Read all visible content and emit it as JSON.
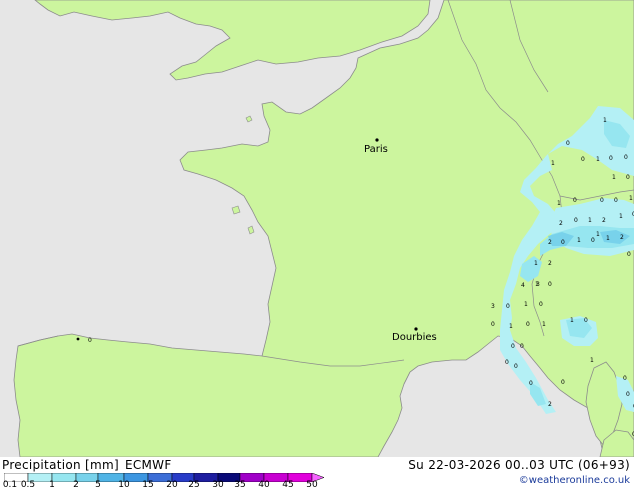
{
  "map": {
    "cities": [
      {
        "name": "Paris"
      },
      {
        "name": "Dourbies"
      }
    ],
    "precip_labels": [
      "1",
      "0",
      "1",
      "0",
      "1",
      "0",
      "0",
      "1",
      "0",
      "1",
      "0",
      "0",
      "0",
      "1",
      "2",
      "0",
      "1",
      "2",
      "1",
      "0",
      "2",
      "0",
      "1",
      "0",
      "1",
      "2",
      "1",
      "2",
      "4",
      "3",
      "3",
      "0",
      "1",
      "0",
      "1",
      "0",
      "1",
      "1",
      "0",
      "0",
      "0",
      "0",
      "2",
      "0",
      "1",
      "0",
      "0",
      "0",
      "0",
      "0",
      "0",
      "0",
      "1",
      "0",
      "0",
      "1"
    ],
    "colors": {
      "land": "#ccf59e",
      "sea": "#e6e6e6",
      "coast": "#8c8c8c",
      "border": "#8c8c8c"
    }
  },
  "footer": {
    "title": "Precipitation [mm]",
    "model": "ECMWF",
    "datetime": "Su 22-03-2026 00..03 UTC (06+93)",
    "credit": "©weatheronline.co.uk"
  },
  "legend": {
    "ticks": [
      "0.1",
      "0.5",
      "1",
      "2",
      "5",
      "10",
      "15",
      "20",
      "25",
      "30",
      "35",
      "40",
      "45",
      "50"
    ],
    "colors": [
      "#ffffff",
      "#b4f0f5",
      "#96e6f0",
      "#78d2eb",
      "#50b4e6",
      "#3c96e1",
      "#3c6ed7",
      "#283cc8",
      "#1e1ea0",
      "#0a0a78",
      "#a000c8",
      "#c800d2",
      "#e100dc",
      "#f000e6",
      "#f564ff"
    ]
  }
}
